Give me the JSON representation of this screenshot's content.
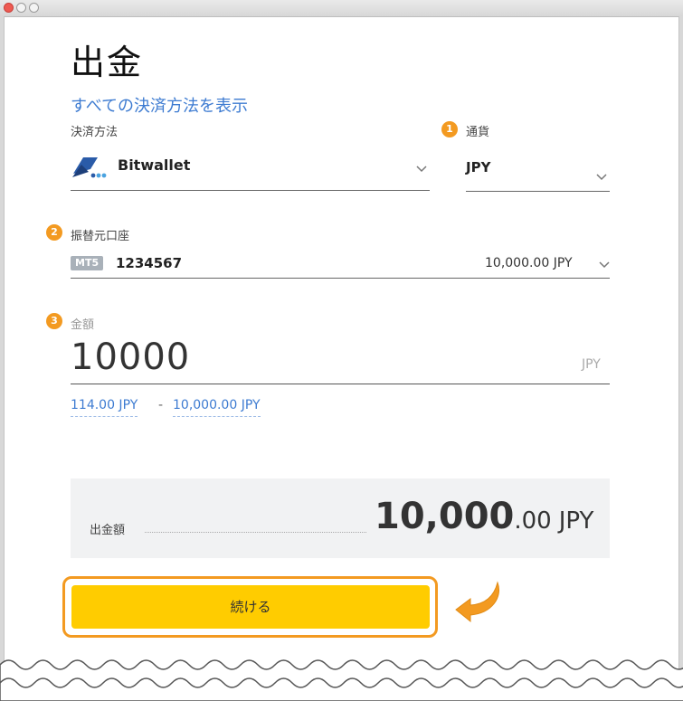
{
  "page": {
    "title": "出金",
    "show_all_methods_link": "すべての決済方法を表示"
  },
  "payment_method": {
    "label": "決済方法",
    "value": "Bitwallet"
  },
  "currency": {
    "badge": "1",
    "label": "通貨",
    "value": "JPY"
  },
  "source_account": {
    "badge": "2",
    "label": "振替元口座",
    "platform": "MT5",
    "account_number": "1234567",
    "balance": "10,000.00 JPY"
  },
  "amount": {
    "badge": "3",
    "label": "金額",
    "value": "10000",
    "currency": "JPY",
    "min": "114.00 JPY",
    "separator": "-",
    "max": "10,000.00 JPY"
  },
  "summary": {
    "label": "出金額",
    "total_integer": "10,000",
    "total_decimal": ".00",
    "total_currency": "JPY"
  },
  "continue_button": {
    "label": "続ける"
  },
  "colors": {
    "accent_orange": "#f39a21",
    "button_yellow": "#ffcc00",
    "link_blue": "#3d7bd1"
  }
}
